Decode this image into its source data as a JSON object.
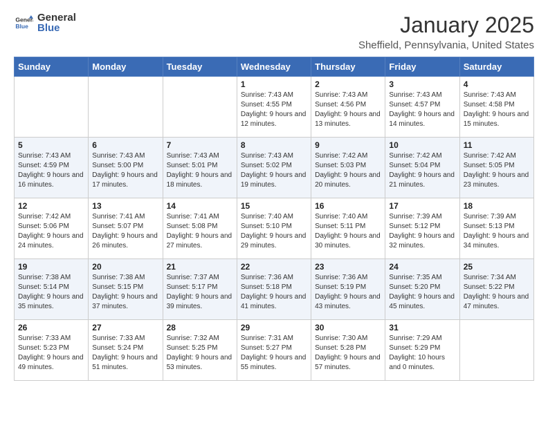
{
  "header": {
    "logo_general": "General",
    "logo_blue": "Blue",
    "month": "January 2025",
    "location": "Sheffield, Pennsylvania, United States"
  },
  "weekdays": [
    "Sunday",
    "Monday",
    "Tuesday",
    "Wednesday",
    "Thursday",
    "Friday",
    "Saturday"
  ],
  "weeks": [
    [
      {
        "day": "",
        "info": ""
      },
      {
        "day": "",
        "info": ""
      },
      {
        "day": "",
        "info": ""
      },
      {
        "day": "1",
        "info": "Sunrise: 7:43 AM\nSunset: 4:55 PM\nDaylight: 9 hours and 12 minutes."
      },
      {
        "day": "2",
        "info": "Sunrise: 7:43 AM\nSunset: 4:56 PM\nDaylight: 9 hours and 13 minutes."
      },
      {
        "day": "3",
        "info": "Sunrise: 7:43 AM\nSunset: 4:57 PM\nDaylight: 9 hours and 14 minutes."
      },
      {
        "day": "4",
        "info": "Sunrise: 7:43 AM\nSunset: 4:58 PM\nDaylight: 9 hours and 15 minutes."
      }
    ],
    [
      {
        "day": "5",
        "info": "Sunrise: 7:43 AM\nSunset: 4:59 PM\nDaylight: 9 hours and 16 minutes."
      },
      {
        "day": "6",
        "info": "Sunrise: 7:43 AM\nSunset: 5:00 PM\nDaylight: 9 hours and 17 minutes."
      },
      {
        "day": "7",
        "info": "Sunrise: 7:43 AM\nSunset: 5:01 PM\nDaylight: 9 hours and 18 minutes."
      },
      {
        "day": "8",
        "info": "Sunrise: 7:43 AM\nSunset: 5:02 PM\nDaylight: 9 hours and 19 minutes."
      },
      {
        "day": "9",
        "info": "Sunrise: 7:42 AM\nSunset: 5:03 PM\nDaylight: 9 hours and 20 minutes."
      },
      {
        "day": "10",
        "info": "Sunrise: 7:42 AM\nSunset: 5:04 PM\nDaylight: 9 hours and 21 minutes."
      },
      {
        "day": "11",
        "info": "Sunrise: 7:42 AM\nSunset: 5:05 PM\nDaylight: 9 hours and 23 minutes."
      }
    ],
    [
      {
        "day": "12",
        "info": "Sunrise: 7:42 AM\nSunset: 5:06 PM\nDaylight: 9 hours and 24 minutes."
      },
      {
        "day": "13",
        "info": "Sunrise: 7:41 AM\nSunset: 5:07 PM\nDaylight: 9 hours and 26 minutes."
      },
      {
        "day": "14",
        "info": "Sunrise: 7:41 AM\nSunset: 5:08 PM\nDaylight: 9 hours and 27 minutes."
      },
      {
        "day": "15",
        "info": "Sunrise: 7:40 AM\nSunset: 5:10 PM\nDaylight: 9 hours and 29 minutes."
      },
      {
        "day": "16",
        "info": "Sunrise: 7:40 AM\nSunset: 5:11 PM\nDaylight: 9 hours and 30 minutes."
      },
      {
        "day": "17",
        "info": "Sunrise: 7:39 AM\nSunset: 5:12 PM\nDaylight: 9 hours and 32 minutes."
      },
      {
        "day": "18",
        "info": "Sunrise: 7:39 AM\nSunset: 5:13 PM\nDaylight: 9 hours and 34 minutes."
      }
    ],
    [
      {
        "day": "19",
        "info": "Sunrise: 7:38 AM\nSunset: 5:14 PM\nDaylight: 9 hours and 35 minutes."
      },
      {
        "day": "20",
        "info": "Sunrise: 7:38 AM\nSunset: 5:15 PM\nDaylight: 9 hours and 37 minutes."
      },
      {
        "day": "21",
        "info": "Sunrise: 7:37 AM\nSunset: 5:17 PM\nDaylight: 9 hours and 39 minutes."
      },
      {
        "day": "22",
        "info": "Sunrise: 7:36 AM\nSunset: 5:18 PM\nDaylight: 9 hours and 41 minutes."
      },
      {
        "day": "23",
        "info": "Sunrise: 7:36 AM\nSunset: 5:19 PM\nDaylight: 9 hours and 43 minutes."
      },
      {
        "day": "24",
        "info": "Sunrise: 7:35 AM\nSunset: 5:20 PM\nDaylight: 9 hours and 45 minutes."
      },
      {
        "day": "25",
        "info": "Sunrise: 7:34 AM\nSunset: 5:22 PM\nDaylight: 9 hours and 47 minutes."
      }
    ],
    [
      {
        "day": "26",
        "info": "Sunrise: 7:33 AM\nSunset: 5:23 PM\nDaylight: 9 hours and 49 minutes."
      },
      {
        "day": "27",
        "info": "Sunrise: 7:33 AM\nSunset: 5:24 PM\nDaylight: 9 hours and 51 minutes."
      },
      {
        "day": "28",
        "info": "Sunrise: 7:32 AM\nSunset: 5:25 PM\nDaylight: 9 hours and 53 minutes."
      },
      {
        "day": "29",
        "info": "Sunrise: 7:31 AM\nSunset: 5:27 PM\nDaylight: 9 hours and 55 minutes."
      },
      {
        "day": "30",
        "info": "Sunrise: 7:30 AM\nSunset: 5:28 PM\nDaylight: 9 hours and 57 minutes."
      },
      {
        "day": "31",
        "info": "Sunrise: 7:29 AM\nSunset: 5:29 PM\nDaylight: 10 hours and 0 minutes."
      },
      {
        "day": "",
        "info": ""
      }
    ]
  ]
}
